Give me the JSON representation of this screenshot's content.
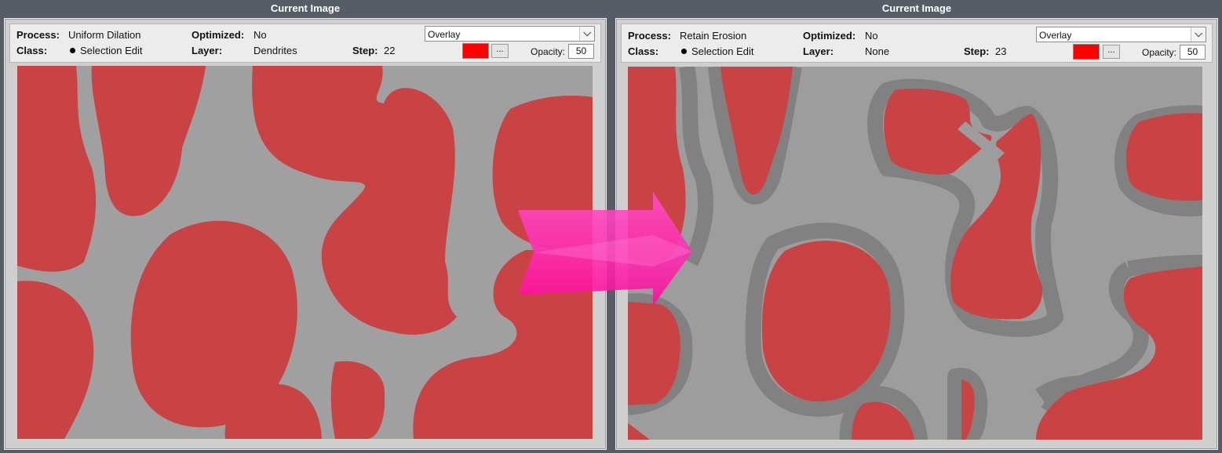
{
  "colors": {
    "background": "#565d66",
    "overlay_swatch": "#ff0000",
    "arrow": "#ff1aa8",
    "region": "#c94344",
    "image_gray": "#9d9d9d"
  },
  "left_panel": {
    "title": "Current Image",
    "process_label": "Process:",
    "process_value": "Uniform Dilation",
    "class_label": "Class:",
    "class_value": "Selection Edit",
    "optimized_label": "Optimized:",
    "optimized_value": "No",
    "layer_label": "Layer:",
    "layer_value": "Dendrites",
    "step_label": "Step:",
    "step_value": "22",
    "mode_select": "Overlay",
    "color_button": "...",
    "opacity_label": "Opacity:",
    "opacity_value": "50"
  },
  "right_panel": {
    "title": "Current Image",
    "process_label": "Process:",
    "process_value": "Retain Erosion",
    "class_label": "Class:",
    "class_value": "Selection Edit",
    "optimized_label": "Optimized:",
    "optimized_value": "No",
    "layer_label": "Layer:",
    "layer_value": "None",
    "step_label": "Step:",
    "step_value": "23",
    "mode_select": "Overlay",
    "color_button": "...",
    "opacity_label": "Opacity:",
    "opacity_value": "50"
  }
}
